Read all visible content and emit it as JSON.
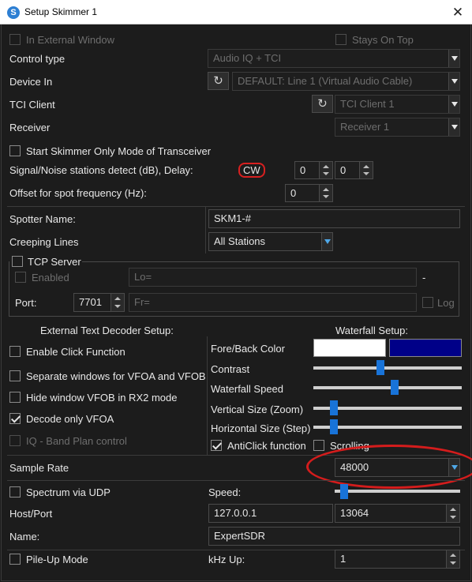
{
  "window": {
    "title": "Setup Skimmer 1",
    "icon_letter": "S",
    "close_glyph": "✕"
  },
  "top": {
    "in_external_window": "In External Window",
    "stays_on_top": "Stays On Top"
  },
  "control_type": {
    "label": "Control type",
    "value": "Audio IQ + TCI"
  },
  "device_in": {
    "label": "Device In",
    "value": "DEFAULT: Line 1 (Virtual Audio Cable)"
  },
  "tci_client": {
    "label": "TCI Client",
    "value": "TCI Client 1"
  },
  "receiver": {
    "label": "Receiver",
    "value": "Receiver 1"
  },
  "start_skimmer_only": "Start Skimmer Only Mode of Transceiver",
  "snr": {
    "label": "Signal/Noise stations detect (dB), Delay:",
    "mode": "CW",
    "value1": "0",
    "value2": "0"
  },
  "offset": {
    "label": "Offset for spot frequency (Hz):",
    "value": "0"
  },
  "spotter": {
    "label": "Spotter Name:",
    "value": "SKM1-#"
  },
  "creeping": {
    "label": "Creeping Lines",
    "value": "All Stations"
  },
  "tcp": {
    "title": "TCP Server",
    "enabled": "Enabled",
    "lo_placeholder": "Lo=",
    "dash": "-",
    "port_label": "Port:",
    "port_value": "7701",
    "fr_placeholder": "Fr=",
    "log": "Log"
  },
  "decoder": {
    "title": "External Text Decoder Setup:",
    "enable_click": "Enable Click Function",
    "separate_windows": "Separate windows for VFOA and VFOB",
    "hide_vfob": "Hide window VFOB in RX2 mode",
    "decode_only_vfoa": "Decode only VFOA",
    "iq_band_plan": "IQ - Band Plan control"
  },
  "waterfall": {
    "title": "Waterfall Setup:",
    "fore_back": "Fore/Back Color",
    "fore_color": "#ffffff",
    "back_color": "#000088",
    "contrast": "Contrast",
    "speed": "Waterfall Speed",
    "vsize": "Vertical Size (Zoom)",
    "hsize": "Horizontal Size (Step)",
    "anticlick": "AntiClick function",
    "scrolling": "Scrolling",
    "levels": {
      "contrast": 0.45,
      "speed": 0.55,
      "vsize": 0.12,
      "hsize": 0.12,
      "udp_speed": 0.05
    }
  },
  "sample_rate": {
    "label": "Sample Rate",
    "value": "48000"
  },
  "udp": {
    "spectrum": "Spectrum via UDP",
    "speed": "Speed:",
    "host_label": "Host/Port",
    "host": "127.0.0.1",
    "port": "13064",
    "name_label": "Name:",
    "name": "ExpertSDR"
  },
  "pileup": {
    "label": "Pile-Up Mode",
    "khz_label": "kHz Up:",
    "khz_value": "1"
  },
  "icons": {
    "refresh": "↻"
  },
  "colors": {
    "accent": "#1873d8",
    "highlight": "#d41c1c"
  }
}
